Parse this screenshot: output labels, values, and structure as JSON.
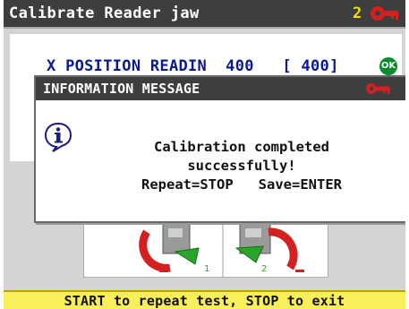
{
  "header": {
    "title": "Calibrate Reader jaw",
    "step_number": "2",
    "logo_icon": "keyline-logo-icon"
  },
  "reading": {
    "label": "X POSITION READIN",
    "value": "400",
    "reference": "[ 400]",
    "ok_badge": "OK",
    "ok_color": "#0a8a2a"
  },
  "dialog": {
    "title": "INFORMATION MESSAGE",
    "icon": "info-icon",
    "line1": "Calibration completed",
    "line2": "successfully!",
    "line3": "Repeat=STOP   Save=ENTER"
  },
  "status": {
    "text": "START to repeat test, STOP to exit",
    "bg_color": "#f9ef5a"
  },
  "colors": {
    "title_bar": "#3e3e3e",
    "accent_red": "#d42020",
    "reading_blue": "#0a1a8c"
  }
}
